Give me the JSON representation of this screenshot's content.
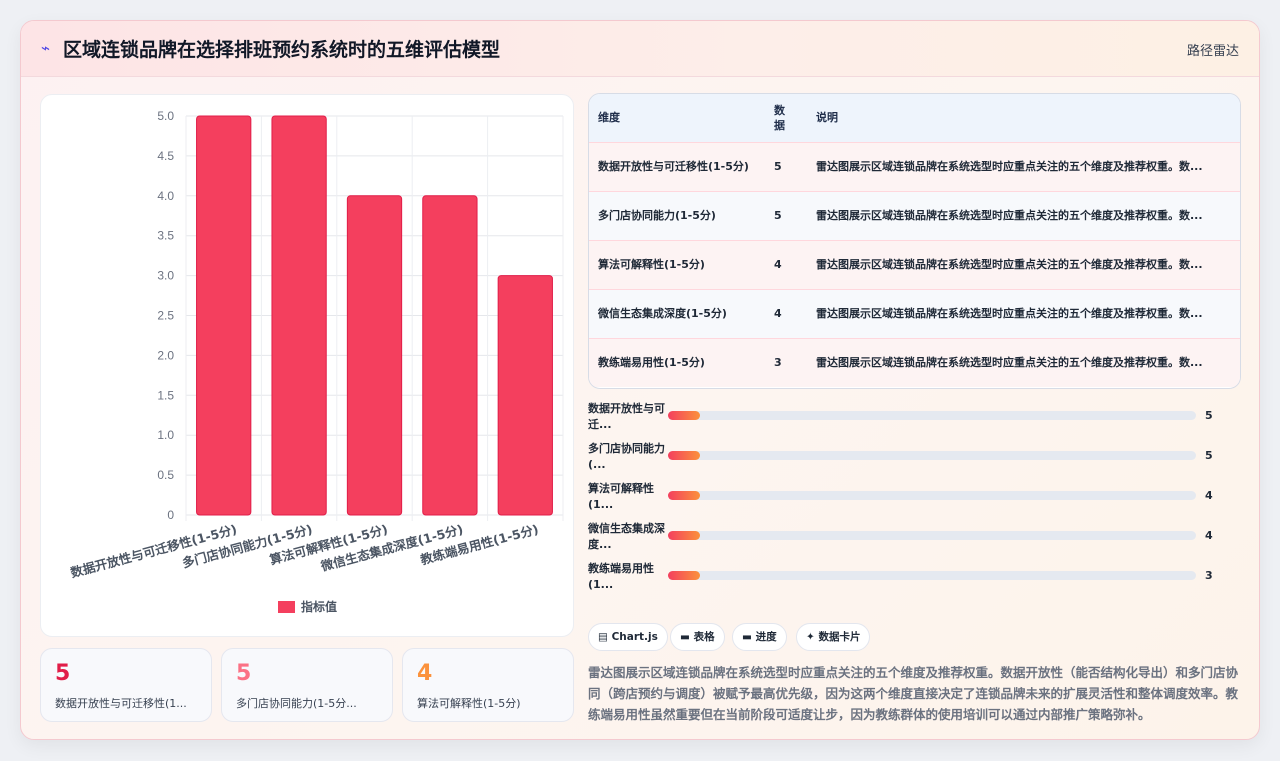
{
  "header": {
    "title_icon": "lightning-icon",
    "title": "区域连锁品牌在选择排班预约系统时的五维评估模型",
    "right_label": "路径雷达"
  },
  "colors": {
    "bar": "#f43f5e",
    "bar_border": "#e11d48",
    "kpi1": "#e11d48",
    "kpi2": "#fb7185",
    "kpi3": "#fb923c"
  },
  "chart_data": {
    "type": "bar",
    "categories": [
      "数据开放性与可迁移性(1-5分)",
      "多门店协同能力(1-5分)",
      "算法可解释性(1-5分)",
      "微信生态集成深度(1-5分)",
      "教练端易用性(1-5分)"
    ],
    "series": [
      {
        "name": "指标值",
        "values": [
          5,
          5,
          4,
          4,
          3
        ]
      }
    ],
    "yticks": [
      "0",
      "0.5",
      "1.0",
      "1.5",
      "2.0",
      "2.5",
      "3.0",
      "3.5",
      "4.0",
      "4.5",
      "5.0"
    ],
    "ylim": [
      0,
      5
    ],
    "grid": true,
    "legend": "bottom"
  },
  "table": {
    "headers": [
      "维度",
      "数据",
      "说明"
    ],
    "rows": [
      {
        "dimension": "数据开放性与可迁移性(1-5分)",
        "value": "5",
        "note": "雷达图展示区域连锁品牌在系统选型时应重点关注的五个维度及推荐权重。数..."
      },
      {
        "dimension": "多门店协同能力(1-5分)",
        "value": "5",
        "note": "雷达图展示区域连锁品牌在系统选型时应重点关注的五个维度及推荐权重。数..."
      },
      {
        "dimension": "算法可解释性(1-5分)",
        "value": "4",
        "note": "雷达图展示区域连锁品牌在系统选型时应重点关注的五个维度及推荐权重。数..."
      },
      {
        "dimension": "微信生态集成深度(1-5分)",
        "value": "4",
        "note": "雷达图展示区域连锁品牌在系统选型时应重点关注的五个维度及推荐权重。数..."
      },
      {
        "dimension": "教练端易用性(1-5分)",
        "value": "3",
        "note": "雷达图展示区域连锁品牌在系统选型时应重点关注的五个维度及推荐权重。数..."
      }
    ]
  },
  "progress": [
    {
      "label": "数据开放性与可迁...",
      "value": "5",
      "fraction": 0.06
    },
    {
      "label": "多门店协同能力(...",
      "value": "5",
      "fraction": 0.06
    },
    {
      "label": "算法可解释性(1...",
      "value": "4",
      "fraction": 0.06
    },
    {
      "label": "微信生态集成深度...",
      "value": "4",
      "fraction": 0.06
    },
    {
      "label": "教练端易用性(1...",
      "value": "3",
      "fraction": 0.06
    }
  ],
  "kpis": [
    {
      "value": "5",
      "label": "数据开放性与可迁移性(1..."
    },
    {
      "value": "5",
      "label": "多门店协同能力(1-5分..."
    },
    {
      "value": "4",
      "label": "算法可解释性(1-5分)"
    }
  ],
  "tags": [
    {
      "icon": "chart-icon",
      "label": "▤ Chart.js"
    },
    {
      "icon": "table-icon",
      "label": "▬ 表格"
    },
    {
      "icon": "progress-icon",
      "label": "▬ 进度"
    },
    {
      "icon": "sparkle-icon",
      "label": "✦ 数据卡片"
    }
  ],
  "description": "雷达图展示区域连锁品牌在系统选型时应重点关注的五个维度及推荐权重。数据开放性（能否结构化导出）和多门店协同（跨店预约与调度）被赋予最高优先级，因为这两个维度直接决定了连锁品牌未来的扩展灵活性和整体调度效率。教练端易用性虽然重要但在当前阶段可适度让步，因为教练群体的使用培训可以通过内部推广策略弥补。"
}
